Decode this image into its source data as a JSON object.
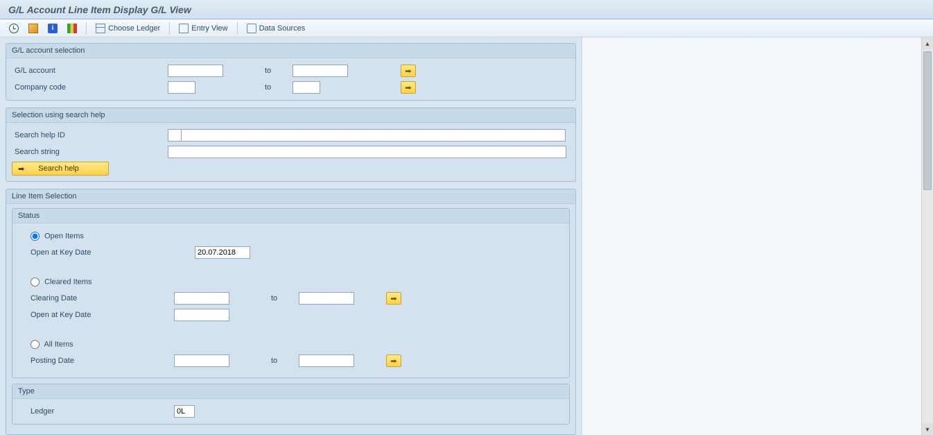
{
  "title": "G/L Account Line Item Display G/L View",
  "toolbar": {
    "choose_ledger_label": "Choose Ledger",
    "entry_view_label": "Entry View",
    "data_sources_label": "Data Sources"
  },
  "gl_selection": {
    "title": "G/L account selection",
    "gl_account_label": "G/L account",
    "company_code_label": "Company code",
    "to_label": "to"
  },
  "search_help": {
    "title": "Selection using search help",
    "id_label": "Search help ID",
    "string_label": "Search string",
    "button_label": "Search help"
  },
  "line_item": {
    "title": "Line Item Selection",
    "status": {
      "title": "Status",
      "open_items_label": "Open Items",
      "open_at_key_date_label": "Open at Key Date",
      "open_at_key_date_value": "20.07.2018",
      "cleared_items_label": "Cleared Items",
      "clearing_date_label": "Clearing Date",
      "open_at_key_date2_label": "Open at Key Date",
      "all_items_label": "All Items",
      "posting_date_label": "Posting Date",
      "to_label": "to"
    },
    "type": {
      "title": "Type",
      "ledger_label": "Ledger",
      "ledger_value": "0L"
    }
  }
}
